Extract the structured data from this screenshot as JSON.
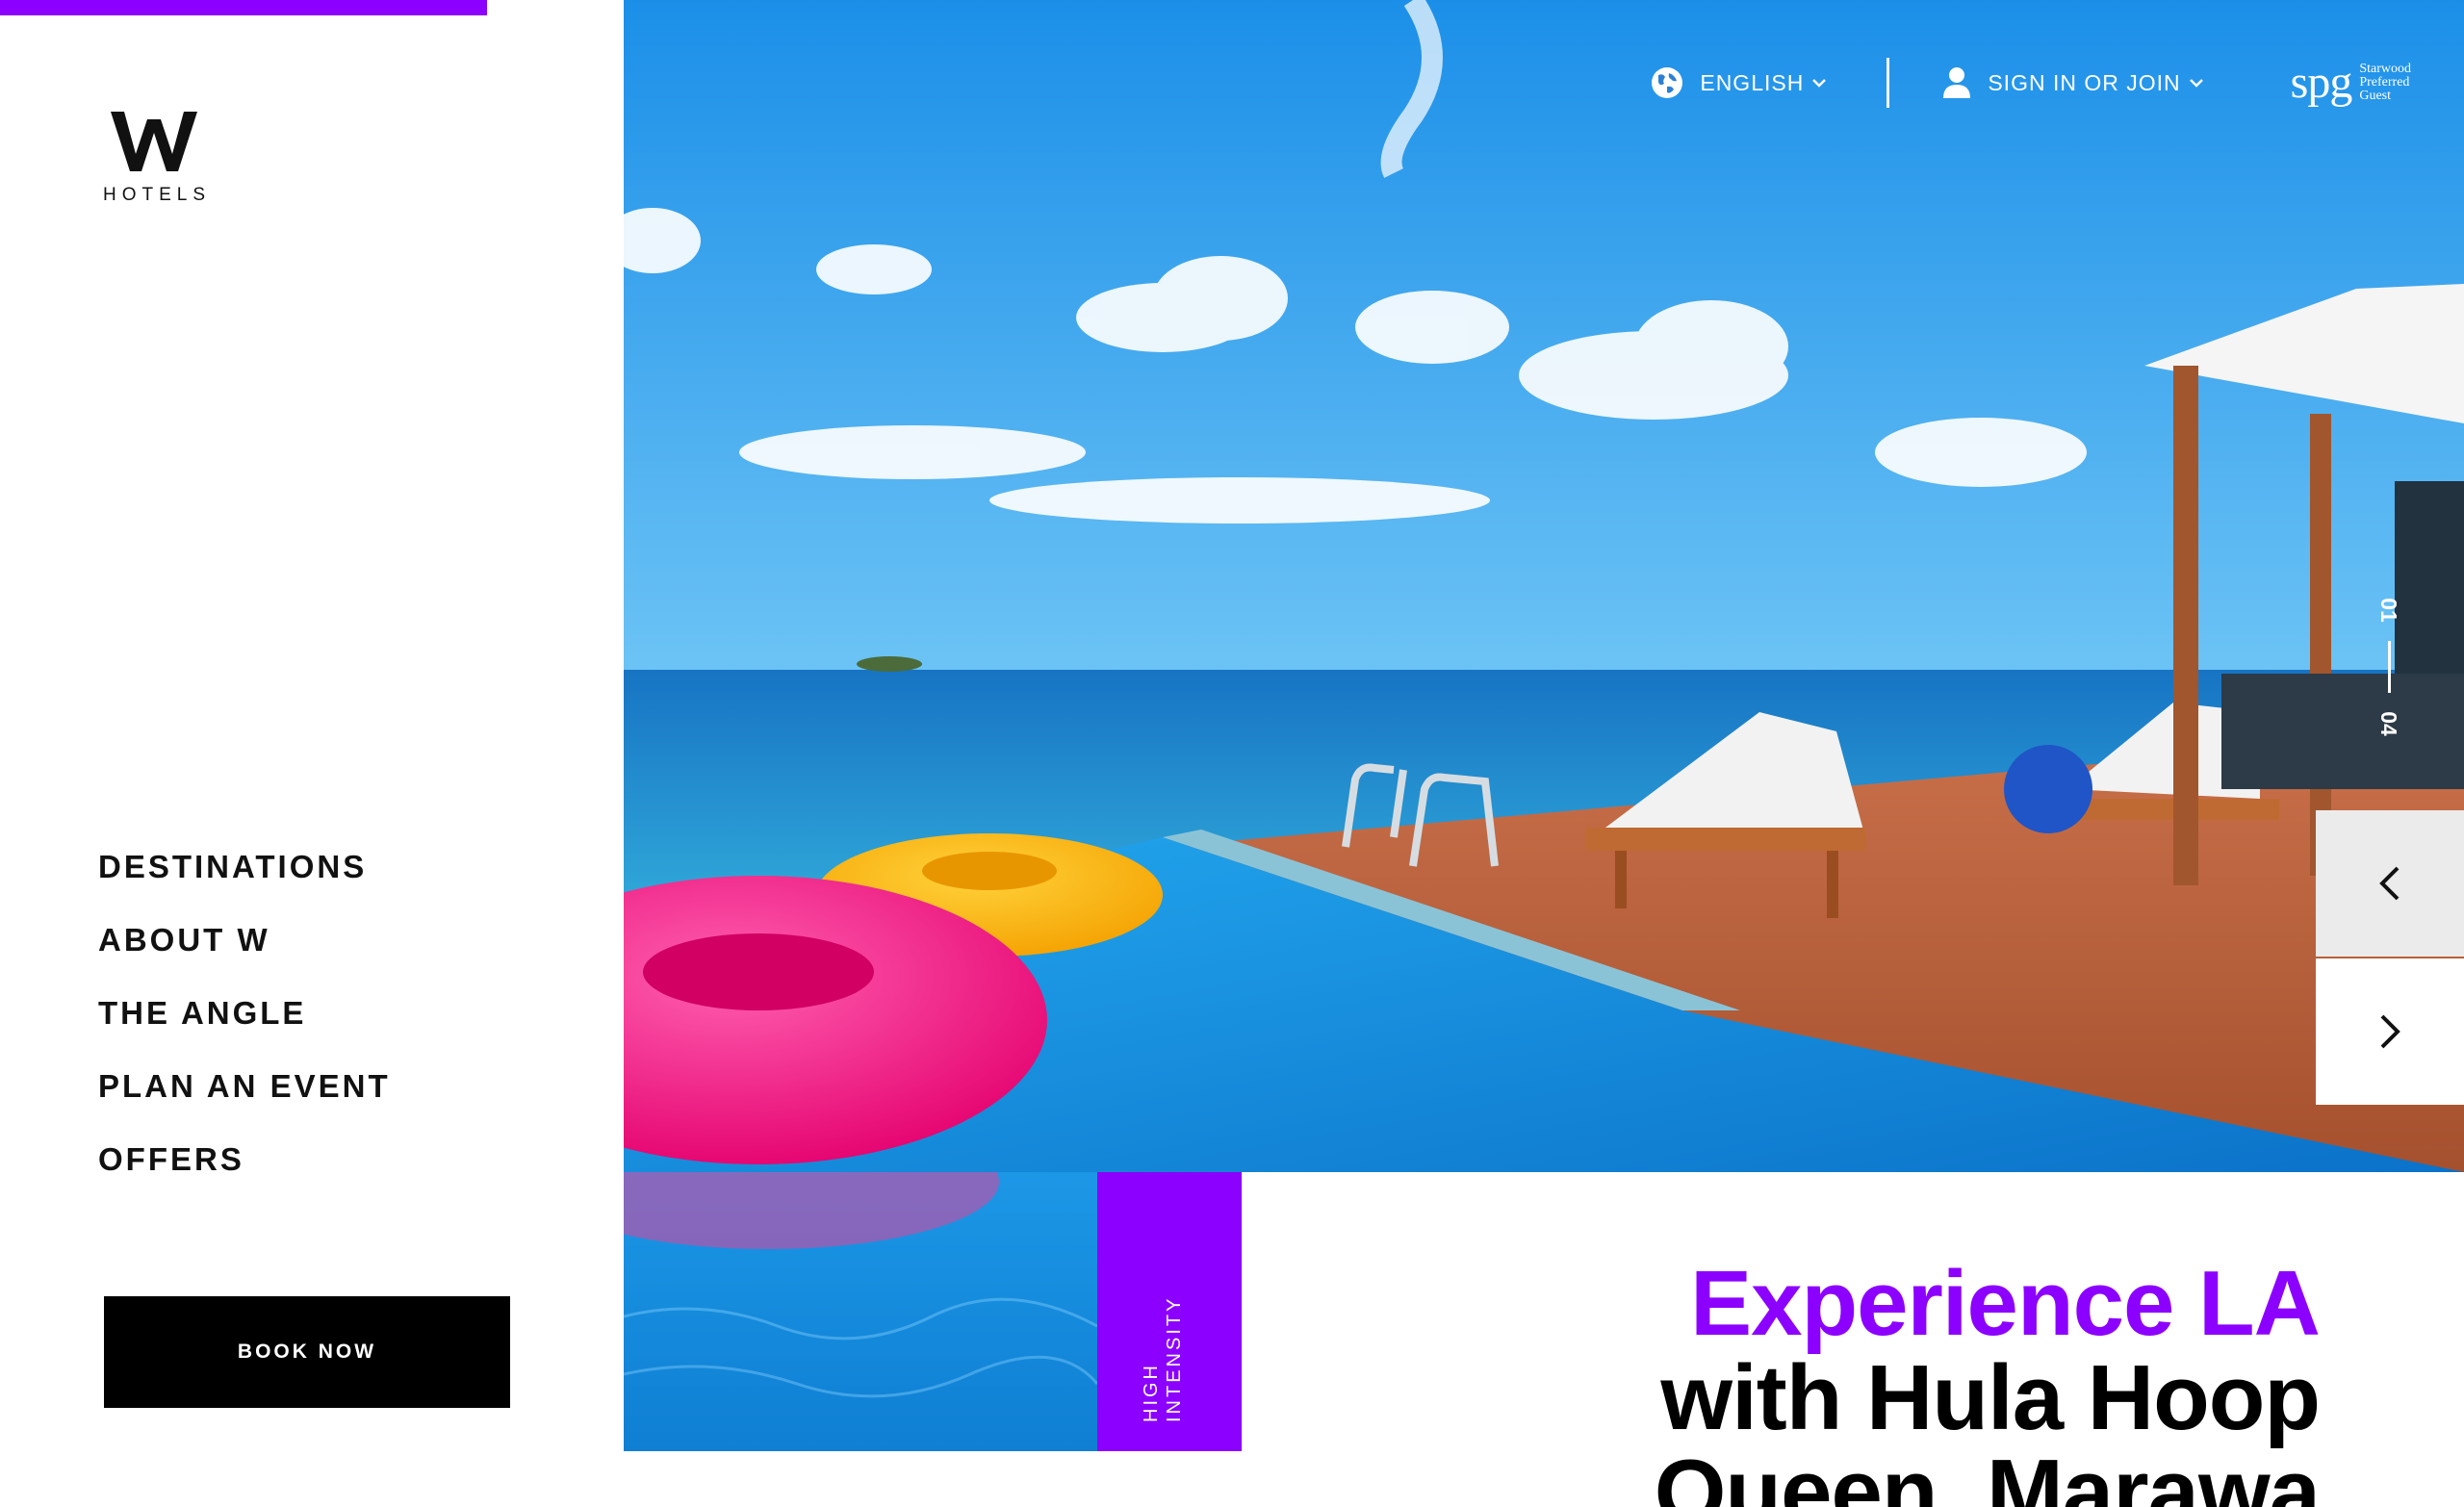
{
  "brand": {
    "logo_letter": "W",
    "logo_text": "HOTELS",
    "accent_color": "#8c00ff"
  },
  "nav": {
    "items": [
      {
        "label": "DESTINATIONS"
      },
      {
        "label": "ABOUT W"
      },
      {
        "label": "THE ANGLE"
      },
      {
        "label": "PLAN AN EVENT"
      },
      {
        "label": "OFFERS"
      }
    ]
  },
  "book_now": {
    "label": "BOOK NOW"
  },
  "topbar": {
    "language": {
      "label": "ENGLISH",
      "icon": "globe-icon"
    },
    "signin": {
      "label": "SIGN IN OR JOIN",
      "icon": "user-icon"
    },
    "spg": {
      "logo": "spg",
      "line1": "Starwood",
      "line2": "Preferred",
      "line3": "Guest"
    }
  },
  "slider": {
    "current": "01",
    "total": "04",
    "prev_icon": "chevron-left-icon",
    "next_icon": "chevron-right-icon"
  },
  "feature": {
    "tag_line1": "HIGH",
    "tag_line2": "INTENSITY",
    "headline_line1": "Experience LA",
    "headline_line2": "with Hula Hoop",
    "headline_line3": "Queen, Marawa"
  }
}
